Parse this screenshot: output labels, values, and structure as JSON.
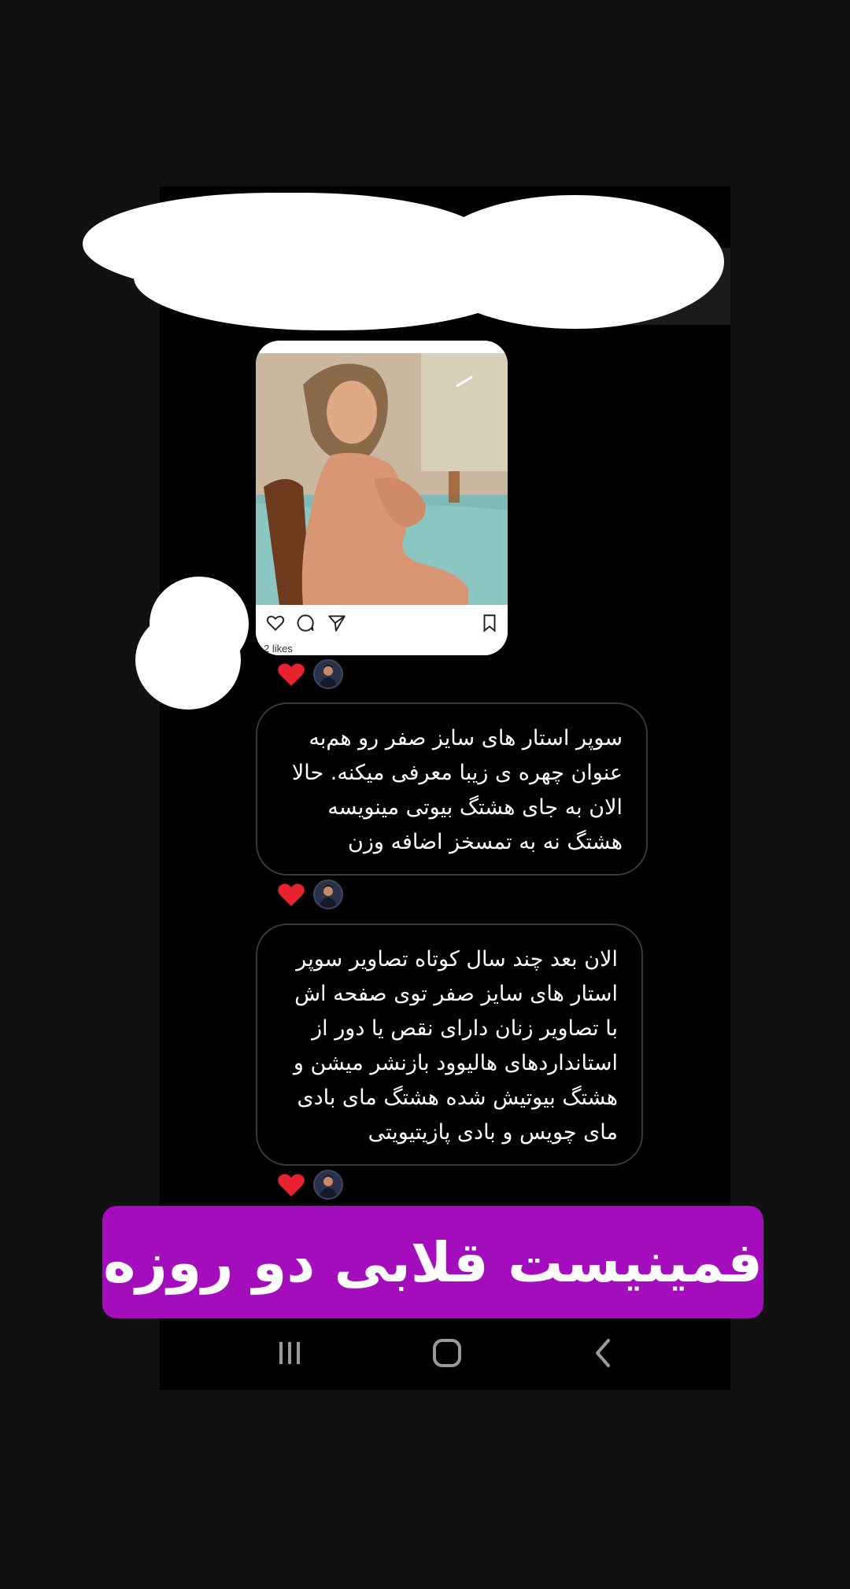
{
  "post": {
    "likes_text": "2 likes",
    "icons": [
      "heart-icon",
      "comment-icon",
      "share-icon",
      "bookmark-icon"
    ]
  },
  "messages": [
    {
      "lines": [
        "سوپر استار های سایز  صفر رو هم‌به",
        "عنوان چهره ی زیبا معرفی میکنه. حالا",
        "الان به جای هشتگ بیوتی مینویسه",
        "هشتگ نه به تمسخز اضافه وزن"
      ]
    },
    {
      "lines": [
        "الان بعد چند سال کوتاه تصاویر سوپر",
        "استار های سایز صفر توی صفحه اش",
        "با تصاویر زنان دارای نقص یا دور از",
        "استانداردهای هالیوود بازنشر میشن و",
        "هشتگ بیوتیش شده هشتگ مای بادی",
        "مای چویس و بادی پازیتیویتی"
      ]
    }
  ],
  "caption": {
    "text": "فمینیست قلابی دو روزه"
  },
  "colors": {
    "background": "#111111",
    "screen": "#000000",
    "caption_bg": "#a30dbc",
    "heart": "#e8232f",
    "bubble_border": "#3a3a3a"
  },
  "nav": {
    "icons": [
      "recent-apps-icon",
      "home-icon",
      "back-icon"
    ]
  }
}
